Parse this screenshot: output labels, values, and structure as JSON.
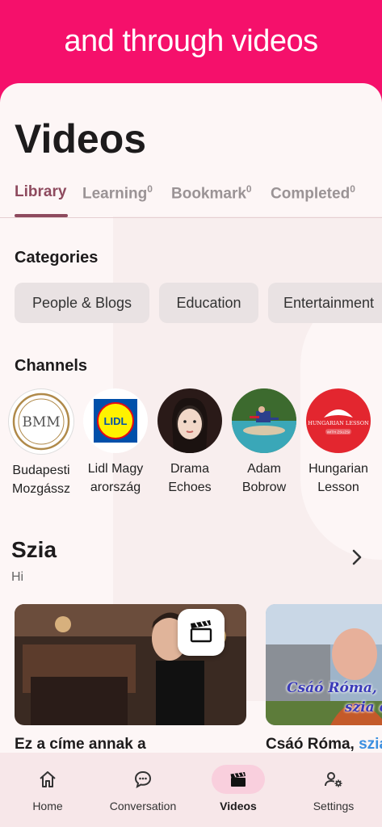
{
  "banner": {
    "text": "and through videos"
  },
  "page": {
    "title": "Videos"
  },
  "tabs": [
    {
      "label": "Library",
      "count": ""
    },
    {
      "label": "Learning",
      "count": "0"
    },
    {
      "label": "Bookmark",
      "count": "0"
    },
    {
      "label": "Completed",
      "count": "0"
    }
  ],
  "categories": {
    "heading": "Categories",
    "items": [
      "People & Blogs",
      "Education",
      "Entertainment"
    ]
  },
  "channels": {
    "heading": "Channels",
    "items": [
      {
        "line1": "Budapesti",
        "line2": "Mozgássz",
        "logo_text": "BMM"
      },
      {
        "line1": "Lidl Magy",
        "line2": "arország",
        "logo_text": "LIDL"
      },
      {
        "line1": "Drama",
        "line2": "Echoes"
      },
      {
        "line1": "Adam",
        "line2": "Bobrow"
      },
      {
        "line1": "Hungarian",
        "line2": "Lesson",
        "logo_text": "HUNGARIAN LESSON",
        "logo_sub": "WITH ZSUZSI"
      }
    ]
  },
  "section": {
    "title": "Szia",
    "subtitle": "Hi"
  },
  "videos": [
    {
      "title": "Ez a címe annak a"
    },
    {
      "title": "Csáó Róma,",
      "title_highlight": "szia",
      "overlay_line1": "Csáó Róma,",
      "overlay_line2": "szia c"
    }
  ],
  "nav": [
    {
      "label": "Home",
      "icon": "home-icon"
    },
    {
      "label": "Conversation",
      "icon": "chat-icon"
    },
    {
      "label": "Videos",
      "icon": "clapperboard-icon",
      "active": true
    },
    {
      "label": "Settings",
      "icon": "user-settings-icon"
    }
  ],
  "colors": {
    "accent": "#f5106b",
    "tab_active": "#8e4a5e",
    "nav_active": "#f9cfdd"
  }
}
